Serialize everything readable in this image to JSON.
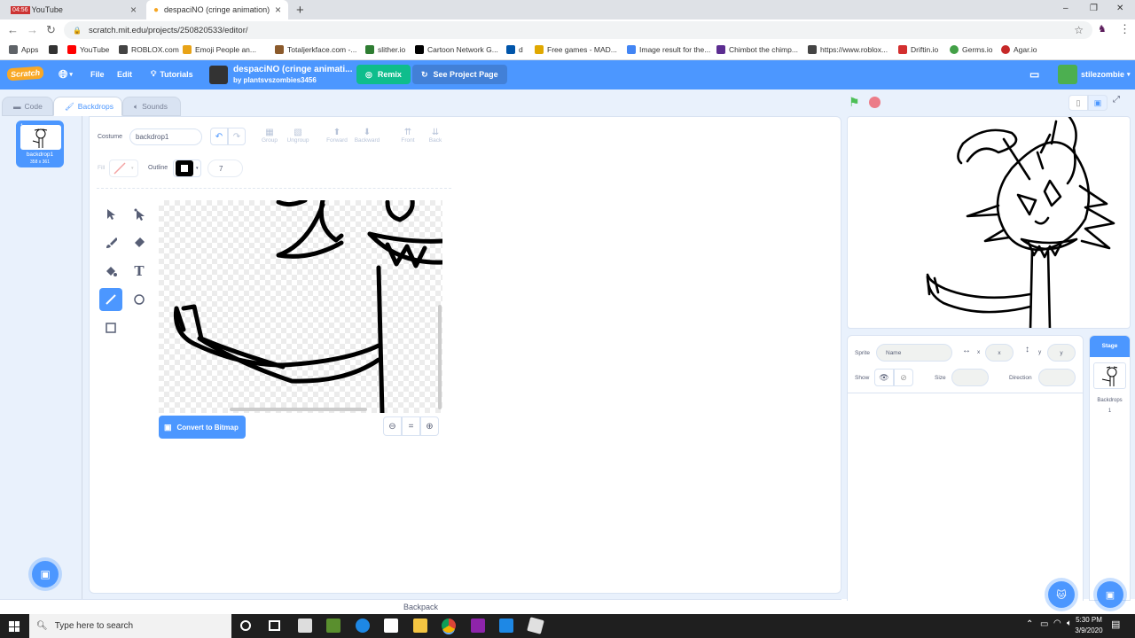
{
  "browser": {
    "tabs": [
      {
        "label": "YouTube",
        "time_badge": "04:56",
        "active": false
      },
      {
        "label": "despaciNO (cringe animation) on S",
        "active": true
      }
    ],
    "new_tab": "+",
    "window_controls": {
      "minimize": "–",
      "restore": "❐",
      "close": "✕"
    },
    "url": "scratch.mit.edu/projects/250820533/editor/",
    "bookmarks": [
      {
        "label": "Apps",
        "color": "#5f6368"
      },
      {
        "label": "",
        "color": "#333333"
      },
      {
        "label": "YouTube",
        "color": "#ff0000"
      },
      {
        "label": "ROBLOX.com",
        "color": "#444444"
      },
      {
        "label": "Emoji People an...",
        "color": "#e8a317"
      },
      {
        "label": "Totaljerkface.com -...",
        "color": "#8b5a2b"
      },
      {
        "label": "slither.io",
        "color": "#2e7d32"
      },
      {
        "label": "Cartoon Network G...",
        "color": "#000000"
      },
      {
        "label": "d",
        "color": "#0055aa"
      },
      {
        "label": "Free games - MAD...",
        "color": "#e0a800"
      },
      {
        "label": "Image result for the...",
        "color": "#4285f4"
      },
      {
        "label": "Chimbot the chimp...",
        "color": "#5c2d91"
      },
      {
        "label": "https://www.roblox...",
        "color": "#444444"
      },
      {
        "label": "Driftin.io",
        "color": "#d32f2f"
      },
      {
        "label": "Germs.io",
        "color": "#43a047"
      },
      {
        "label": "Agar.io",
        "color": "#c62828"
      }
    ]
  },
  "scratch": {
    "logo": "Scratch",
    "menu": {
      "file": "File",
      "edit": "Edit",
      "tutorials": "Tutorials"
    },
    "project": {
      "title": "despaciNO (cringe animati...",
      "author": "by plantsvszombies3456"
    },
    "remix_label": "Remix",
    "see_project_label": "See Project Page",
    "username": "stilezombie",
    "tabs": {
      "code": "Code",
      "backdrops": "Backdrops",
      "sounds": "Sounds"
    },
    "costume_list": [
      {
        "index": "1",
        "name": "backdrop1",
        "size": "358 x 361"
      }
    ],
    "paint": {
      "costume_label": "Costume",
      "costume_name": "backdrop1",
      "group": "Group",
      "ungroup": "Ungroup",
      "forward": "Forward",
      "backward": "Backward",
      "front": "Front",
      "back": "Back",
      "fill_label": "Fill",
      "outline_label": "Outline",
      "outline_width": "7",
      "convert_label": "Convert to Bitmap",
      "zoom_reset": "="
    },
    "sprite_info": {
      "sprite_label": "Sprite",
      "name_placeholder": "Name",
      "x_label": "x",
      "x_placeholder": "x",
      "y_label": "y",
      "y_placeholder": "y",
      "show_label": "Show",
      "size_label": "Size",
      "direction_label": "Direction"
    },
    "stage_col": {
      "title": "Stage",
      "backdrops_label": "Backdrops",
      "backdrops_count": "1"
    },
    "backpack": "Backpack",
    "colors": {
      "accent": "#4c97ff",
      "remix": "#0fbd8c",
      "menubar": "#4c97ff"
    }
  },
  "taskbar": {
    "search_placeholder": "Type here to search",
    "time": "5:30 PM",
    "date": "3/9/2020"
  }
}
